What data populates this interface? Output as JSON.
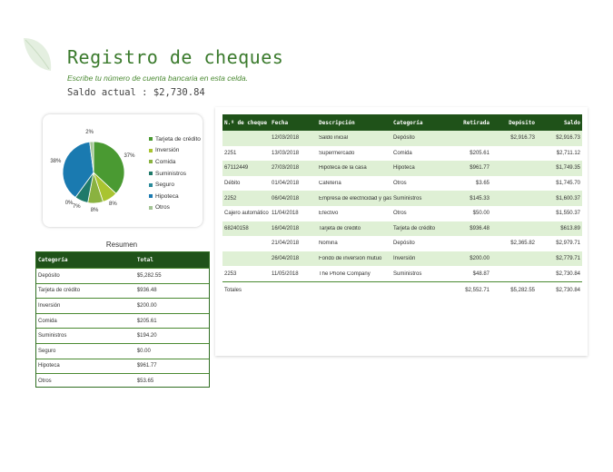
{
  "header": {
    "title": "Registro de cheques",
    "hint": "Escribe tu número de cuenta bancaria en esta celda.",
    "balance": "Saldo actual : $2,730.84"
  },
  "colors": {
    "accent": "#3a7a2c",
    "header_fill": "#1f5219",
    "band": "#dff0d5"
  },
  "chart_data": {
    "type": "pie",
    "slices": [
      {
        "label": "Tarjeta de crédito",
        "value": 37,
        "value_label": "37%",
        "color": "#4a9a32"
      },
      {
        "label": "Inversión",
        "value": 8,
        "value_label": "8%",
        "color": "#a9c431"
      },
      {
        "label": "Comida",
        "value": 8,
        "value_label": "8%",
        "color": "#8ab240"
      },
      {
        "label": "Suministros",
        "value": 7,
        "value_label": "7%",
        "color": "#1f7a6a"
      },
      {
        "label": "Seguro",
        "value": 0,
        "value_label": "0%",
        "color": "#2a8a9a"
      },
      {
        "label": "Hipoteca",
        "value": 38,
        "value_label": "38%",
        "color": "#1a7ab0"
      },
      {
        "label": "Otros",
        "value": 2,
        "value_label": "2%",
        "color": "#a3c494"
      }
    ]
  },
  "summary": {
    "title": "Resumen",
    "headers": [
      "Categoría",
      "Total"
    ],
    "rows": [
      [
        "Depósito",
        "$5,282.55"
      ],
      [
        "Tarjeta de crédito",
        "$936.48"
      ],
      [
        "Inversión",
        "$200.00"
      ],
      [
        "Comida",
        "$205.61"
      ],
      [
        "Suministros",
        "$194.20"
      ],
      [
        "Seguro",
        "$0.00"
      ],
      [
        "Hipoteca",
        "$961.77"
      ],
      [
        "Otros",
        "$53.65"
      ]
    ]
  },
  "register": {
    "headers": [
      "N.º de cheque",
      "Fecha",
      "Descripción",
      "Categoría",
      "Retirada",
      "Depósito",
      "Saldo"
    ],
    "rows": [
      [
        "",
        "12/03/2018",
        "Saldo inicial",
        "Depósito",
        "",
        "$2,916.73",
        "$2,916.73"
      ],
      [
        "2251",
        "13/03/2018",
        "Supermercado",
        "Comida",
        "$205.61",
        "",
        "$2,711.12"
      ],
      [
        "67112449",
        "27/03/2018",
        "Hipoteca de la casa",
        "Hipoteca",
        "$961.77",
        "",
        "$1,749.35"
      ],
      [
        "Débito",
        "01/04/2018",
        "Cafetería",
        "Otros",
        "$3.65",
        "",
        "$1,745.70"
      ],
      [
        "2252",
        "06/04/2018",
        "Empresa de electricidad y gas",
        "Suministros",
        "$145.33",
        "",
        "$1,600.37"
      ],
      [
        "Cajero automático",
        "11/04/2018",
        "Efectivo",
        "Otros",
        "$50.00",
        "",
        "$1,550.37"
      ],
      [
        "68240158",
        "16/04/2018",
        "Tarjeta de crédito",
        "Tarjeta de crédito",
        "$936.48",
        "",
        "$613.89"
      ],
      [
        "",
        "21/04/2018",
        "Nómina",
        "Depósito",
        "",
        "$2,365.82",
        "$2,979.71"
      ],
      [
        "",
        "26/04/2018",
        "Fondo de inversión mutuo",
        "Inversión",
        "$200.00",
        "",
        "$2,779.71"
      ],
      [
        "2253",
        "11/05/2018",
        "The Phone Company",
        "Suministros",
        "$48.87",
        "",
        "$2,730.84"
      ]
    ],
    "totals": [
      "Totales",
      "",
      "",
      "",
      "$2,552.71",
      "$5,282.55",
      "$2,730.84"
    ]
  }
}
